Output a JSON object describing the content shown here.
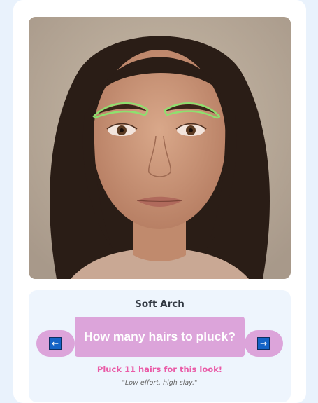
{
  "photo": {
    "subject": "face-portrait",
    "overlay_color": "#8ee06e"
  },
  "look": {
    "name": "Soft Arch"
  },
  "question": {
    "label": "How many hairs to pluck?"
  },
  "nav": {
    "prev_icon": "arrow-left-icon",
    "prev_glyph": "←",
    "next_icon": "arrow-right-icon",
    "next_glyph": "→"
  },
  "result": {
    "text": "Pluck 11 hairs for this look!",
    "tagline": "\"Low effort, high slay.\""
  },
  "colors": {
    "background": "#e9f2fc",
    "card": "#ffffff",
    "panel": "#eef5fd",
    "button": "#dca4da",
    "accent_pink": "#ea5ba7",
    "arrow_blue": "#1463c6"
  }
}
